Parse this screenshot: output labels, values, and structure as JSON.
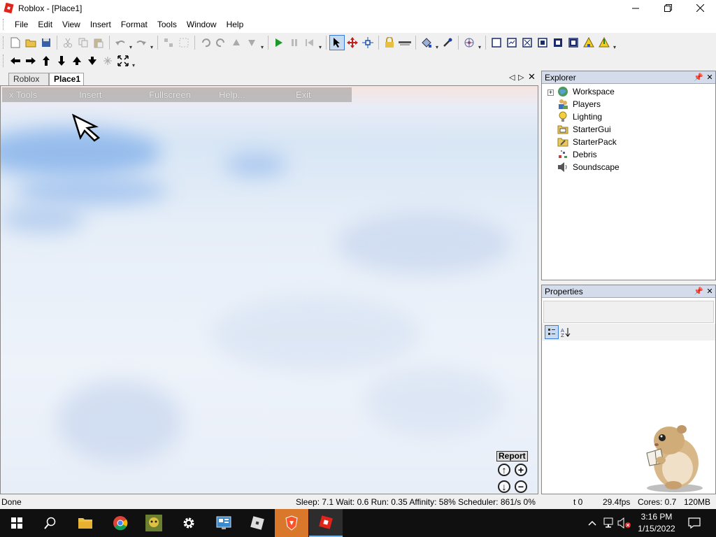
{
  "window": {
    "title": "Roblox - [Place1]"
  },
  "menu": [
    "File",
    "Edit",
    "View",
    "Insert",
    "Format",
    "Tools",
    "Window",
    "Help"
  ],
  "tabs": {
    "roblox": "Roblox",
    "place1": "Place1"
  },
  "gui_menu": {
    "tools": "x Tools",
    "insert": "Insert",
    "fullscreen": "Fullscreen",
    "help": "Help...",
    "exit": "Exit"
  },
  "report": "Report",
  "explorer": {
    "title": "Explorer",
    "items": [
      "Workspace",
      "Players",
      "Lighting",
      "StarterGui",
      "StarterPack",
      "Debris",
      "Soundscape"
    ]
  },
  "properties": {
    "title": "Properties"
  },
  "status": {
    "left": "Done",
    "stats": "Sleep: 7.1 Wait: 0.6 Run: 0.35 Affinity: 58% Scheduler: 861/s 0%",
    "t": "t 0",
    "fps": "29.4fps",
    "cores": "Cores: 0.7",
    "mem": "120MB"
  },
  "clock": {
    "time": "3:16 PM",
    "date": "1/15/2022"
  },
  "colors": {
    "accent": "#3a7bd5",
    "panel_head": "#d4dcec",
    "taskbar": "#101010",
    "roblox_red": "#e2231a"
  }
}
